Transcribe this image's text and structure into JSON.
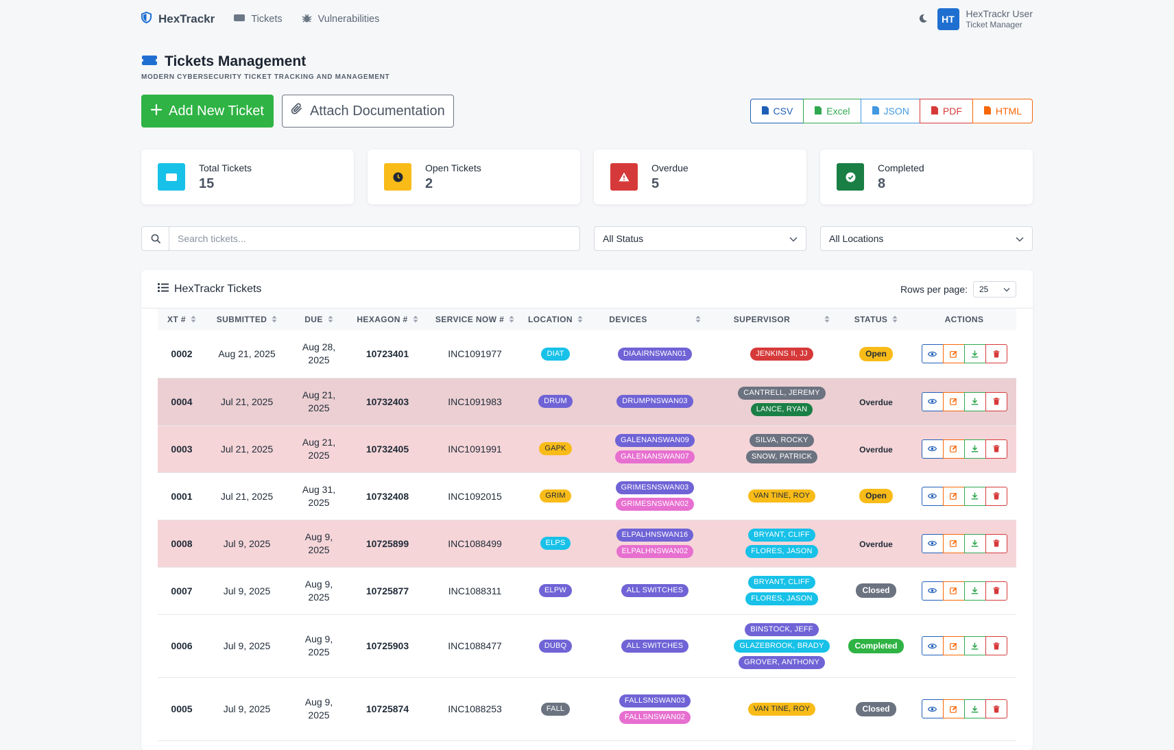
{
  "nav": {
    "brand": "HexTrackr",
    "links": [
      "Tickets",
      "Vulnerabilities"
    ],
    "user_name": "HexTrackr User",
    "user_role": "Ticket Manager",
    "avatar_initials": "HT"
  },
  "page": {
    "title": "Tickets Management",
    "subtitle": "MODERN CYBERSECURITY TICKET TRACKING AND MANAGEMENT"
  },
  "actions": {
    "add_label": "Add New Ticket",
    "attach_label": "Attach Documentation",
    "exports": [
      {
        "label": "CSV",
        "color": "#1f5fb8"
      },
      {
        "label": "Excel",
        "color": "#2fa84f"
      },
      {
        "label": "JSON",
        "color": "#4299e1"
      },
      {
        "label": "PDF",
        "color": "#d63939"
      },
      {
        "label": "HTML",
        "color": "#f76707"
      }
    ]
  },
  "stats": [
    {
      "label": "Total Tickets",
      "value": "15",
      "color": "#17c1e8",
      "icon": "ticket-icon"
    },
    {
      "label": "Open Tickets",
      "value": "2",
      "color": "#f8bb18",
      "icon": "clock-icon"
    },
    {
      "label": "Overdue",
      "value": "5",
      "color": "#d63939",
      "icon": "warning-icon"
    },
    {
      "label": "Completed",
      "value": "8",
      "color": "#1a7f45",
      "icon": "check-circle-icon"
    }
  ],
  "filters": {
    "search_placeholder": "Search tickets...",
    "status_selected": "All Status",
    "location_selected": "All Locations"
  },
  "table": {
    "title": "HexTrackr Tickets",
    "rows_per_page_label": "Rows per page:",
    "rows_per_page_value": "25",
    "columns": [
      "XT #",
      "SUBMITTED",
      "DUE",
      "HEXAGON #",
      "SERVICE NOW #",
      "LOCATION",
      "DEVICES",
      "SUPERVISOR",
      "STATUS",
      "ACTIONS"
    ],
    "rows": [
      {
        "xt": "0002",
        "submitted": "Aug 21, 2025",
        "due1": "Aug 28,",
        "due2": "2025",
        "hexagon": "10723401",
        "servicenow": "INC1091977",
        "location": "DIAT",
        "devices": [
          "DIAAIRNSWAN01"
        ],
        "supervisors": [
          "JENKINS II, JJ"
        ],
        "status": "Open"
      },
      {
        "xt": "0004",
        "submitted": "Jul 21, 2025",
        "due1": "Aug 21,",
        "due2": "2025",
        "hexagon": "10732403",
        "servicenow": "INC1091983",
        "location": "DRUM",
        "devices": [
          "DRUMPNSWAN03"
        ],
        "supervisors": [
          "CANTRELL, JEREMY",
          "LANCE, RYAN"
        ],
        "status": "Overdue"
      },
      {
        "xt": "0003",
        "submitted": "Jul 21, 2025",
        "due1": "Aug 21,",
        "due2": "2025",
        "hexagon": "10732405",
        "servicenow": "INC1091991",
        "location": "GAPK",
        "devices": [
          "GALENANSWAN09",
          "GALENANSWAN07"
        ],
        "supervisors": [
          "SILVA, ROCKY",
          "SNOW, PATRICK"
        ],
        "status": "Overdue"
      },
      {
        "xt": "0001",
        "submitted": "Jul 21, 2025",
        "due1": "Aug 31,",
        "due2": "2025",
        "hexagon": "10732408",
        "servicenow": "INC1092015",
        "location": "GRIM",
        "devices": [
          "GRIMESNSWAN03",
          "GRIMESNSWAN02"
        ],
        "supervisors": [
          "VAN TINE, ROY"
        ],
        "status": "Open"
      },
      {
        "xt": "0008",
        "submitted": "Jul 9, 2025",
        "due1": "Aug 9,",
        "due2": "2025",
        "hexagon": "10725899",
        "servicenow": "INC1088499",
        "location": "ELPS",
        "devices": [
          "ELPALHNSWAN16",
          "ELPALHNSWAN02"
        ],
        "supervisors": [
          "BRYANT, CLIFF",
          "FLORES, JASON"
        ],
        "status": "Overdue"
      },
      {
        "xt": "0007",
        "submitted": "Jul 9, 2025",
        "due1": "Aug 9,",
        "due2": "2025",
        "hexagon": "10725877",
        "servicenow": "INC1088311",
        "location": "ELPW",
        "devices": [
          "ALL SWITCHES"
        ],
        "supervisors": [
          "BRYANT, CLIFF",
          "FLORES, JASON"
        ],
        "status": "Closed"
      },
      {
        "xt": "0006",
        "submitted": "Jul 9, 2025",
        "due1": "Aug 9,",
        "due2": "2025",
        "hexagon": "10725903",
        "servicenow": "INC1088477",
        "location": "DUBQ",
        "devices": [
          "ALL SWITCHES"
        ],
        "supervisors": [
          "BINSTOCK, JEFF",
          "GLAZEBROOK, BRADY",
          "GROVER, ANTHONY"
        ],
        "status": "Completed"
      },
      {
        "xt": "0005",
        "submitted": "Jul 9, 2025",
        "due1": "Aug 9,",
        "due2": "2025",
        "hexagon": "10725874",
        "servicenow": "INC1088253",
        "location": "FALL",
        "devices": [
          "FALLSNSWAN03",
          "FALLSNSWAN02"
        ],
        "supervisors": [
          "VAN TINE, ROY"
        ],
        "status": "Closed"
      }
    ]
  }
}
